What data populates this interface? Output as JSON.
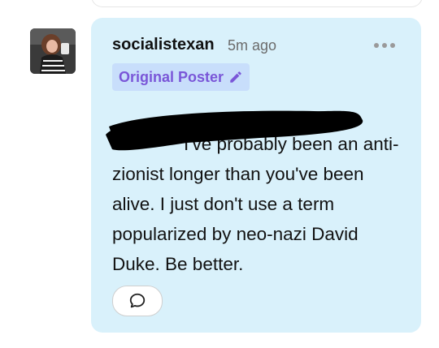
{
  "comment": {
    "username": "socialistexan",
    "timestamp": "5m ago",
    "badge_label": "Original Poster",
    "badge_icon": "pencil-icon",
    "body": "I've probably been an anti-zionist longer than you've been alive. I just don't use a term popularized by neo-nazi David Duke. Be better.",
    "more_icon": "more-options-icon",
    "reply_icon": "comment-bubble-icon"
  },
  "colors": {
    "card_background": "#d9f1fb",
    "badge_background": "#c8defb",
    "badge_text": "#7a56d8",
    "redaction": "#000000"
  }
}
